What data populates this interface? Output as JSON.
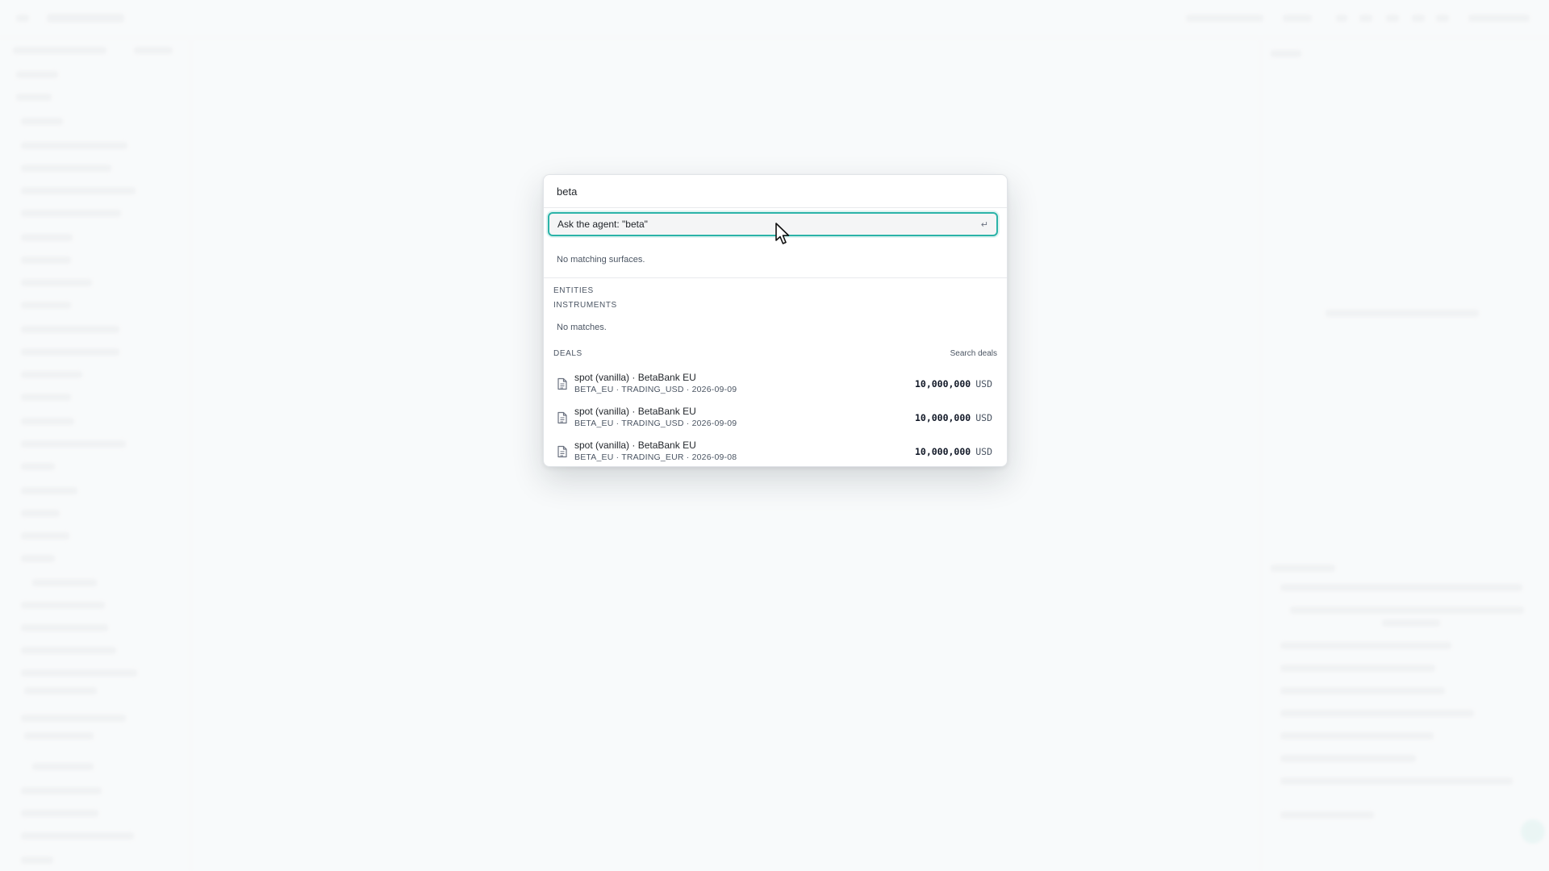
{
  "palette": {
    "query": "beta",
    "agent_prompt": "Ask the agent: \"beta\"",
    "enter_glyph": "↵",
    "no_surfaces": "No matching surfaces.",
    "sections": {
      "entities": "ENTITIES",
      "instruments": "INSTRUMENTS",
      "instruments_empty": "No matches.",
      "deals": "DEALS",
      "search_deals": "Search deals"
    },
    "deals": [
      {
        "title": "spot (vanilla) · BetaBank EU",
        "sub": "BETA_EU · TRADING_USD · 2026-09-09",
        "amount": "10,000,000",
        "ccy": "USD"
      },
      {
        "title": "spot (vanilla) · BetaBank EU",
        "sub": "BETA_EU · TRADING_USD · 2026-09-09",
        "amount": "10,000,000",
        "ccy": "USD"
      },
      {
        "title": "spot (vanilla) · BetaBank EU",
        "sub": "BETA_EU · TRADING_EUR · 2026-09-08",
        "amount": "10,000,000",
        "ccy": "USD"
      }
    ]
  },
  "icons": {
    "deal": "document-icon",
    "cursor": "mouse-pointer-icon"
  },
  "colors": {
    "focus_ring": "#2bb3a8",
    "text": "#1f2328",
    "muted": "#4b5563"
  }
}
